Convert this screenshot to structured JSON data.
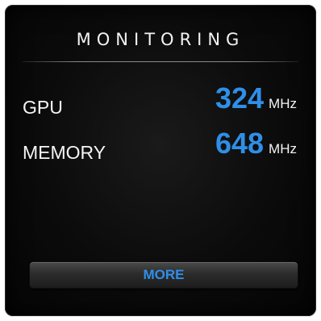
{
  "widget": {
    "title": "MONITORING",
    "accent_color": "#2f8fe8"
  },
  "metrics": [
    {
      "label": "GPU",
      "value": "324",
      "unit": "MHz"
    },
    {
      "label": "MEMORY",
      "value": "648",
      "unit": "MHz"
    }
  ],
  "more_button": {
    "label": "MORE"
  }
}
